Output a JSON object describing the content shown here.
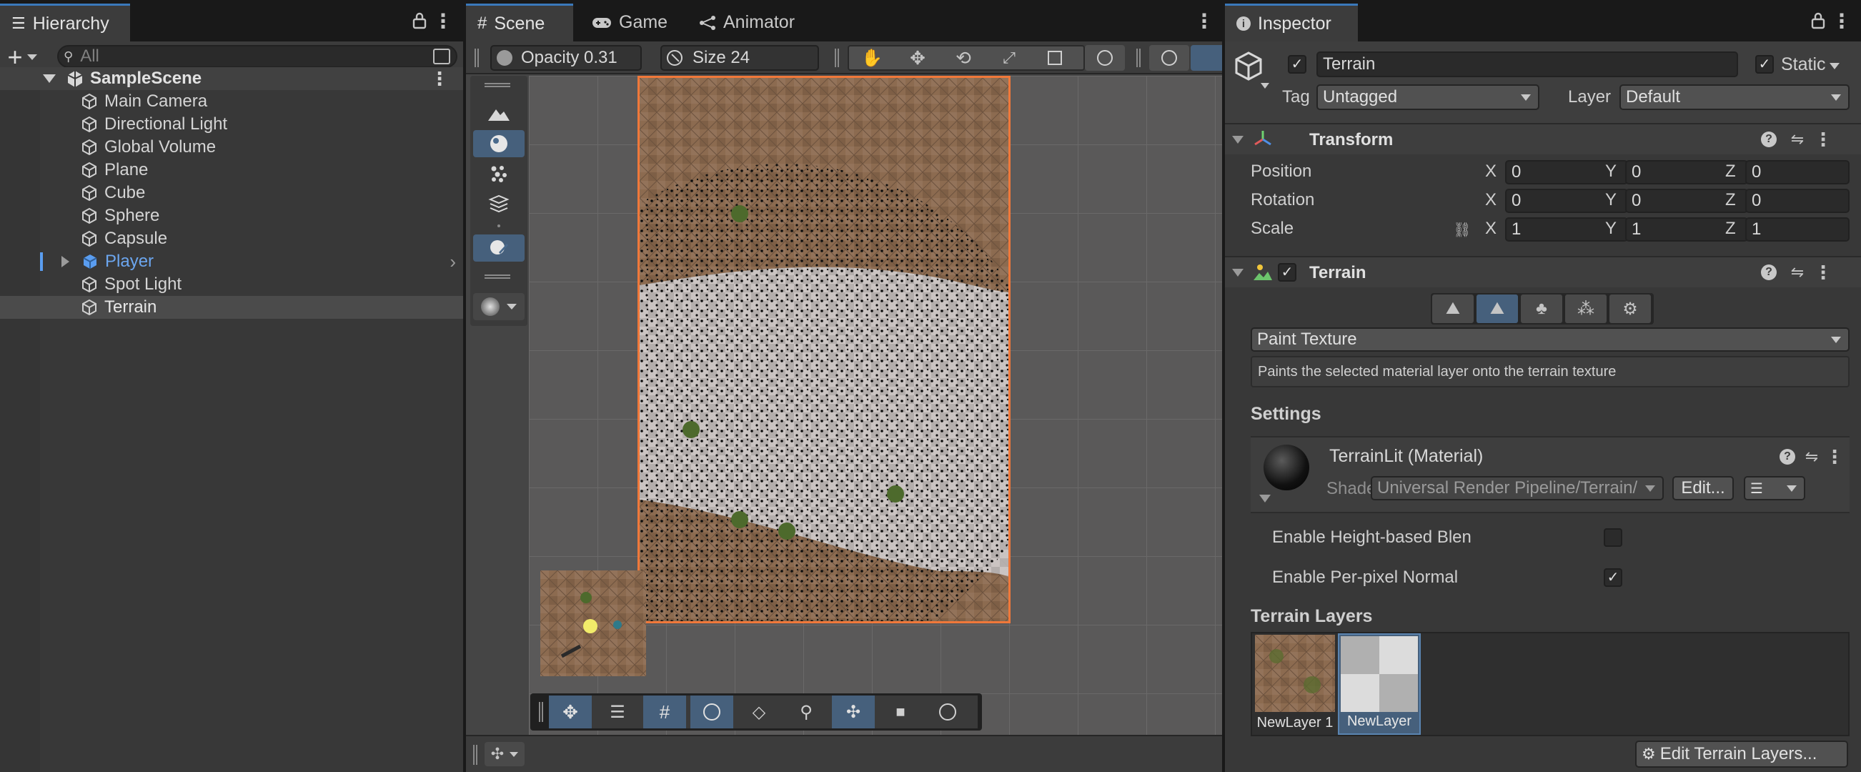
{
  "hierarchy": {
    "tab_label": "Hierarchy",
    "search_placeholder": "All",
    "scene_name": "SampleScene",
    "items": [
      {
        "label": "Main Camera"
      },
      {
        "label": "Directional Light"
      },
      {
        "label": "Global Volume"
      },
      {
        "label": "Plane"
      },
      {
        "label": "Cube"
      },
      {
        "label": "Sphere"
      },
      {
        "label": "Capsule"
      },
      {
        "label": "Player"
      },
      {
        "label": "Spot Light"
      },
      {
        "label": "Terrain"
      }
    ],
    "selected_item": "Terrain",
    "highlight_color": "#5a9df0"
  },
  "scene": {
    "tabs": [
      {
        "label": "Scene"
      },
      {
        "label": "Game"
      },
      {
        "label": "Animator"
      }
    ],
    "active_tab": "Scene",
    "toolbar": {
      "opacity_label": "Opacity 0.31",
      "size_label": "Size 24"
    },
    "selection_color": "#f0783a"
  },
  "inspector": {
    "tab_label": "Inspector",
    "object_name": "Terrain",
    "static_label": "Static",
    "tag_label": "Tag",
    "tag_value": "Untagged",
    "layer_label": "Layer",
    "layer_value": "Default",
    "transform": {
      "title": "Transform",
      "rows": [
        {
          "label": "Position",
          "x": "0",
          "y": "0",
          "z": "0"
        },
        {
          "label": "Rotation",
          "x": "0",
          "y": "0",
          "z": "0"
        },
        {
          "label": "Scale",
          "x": "1",
          "y": "1",
          "z": "1"
        }
      ],
      "axis_x": "X",
      "axis_y": "Y",
      "axis_z": "Z"
    },
    "terrain": {
      "title": "Terrain",
      "tool_dropdown": "Paint Texture",
      "tool_description": "Paints the selected material layer onto the terrain texture",
      "settings_label": "Settings",
      "material_name": "TerrainLit (Material)",
      "shader_label": "Shader",
      "shader_value": "Universal Render Pipeline/Terrain/",
      "edit_label": "Edit...",
      "height_blend_label": "Enable Height-based Blen",
      "per_pixel_normal_label": "Enable Per-pixel Normal",
      "height_blend_checked": false,
      "per_pixel_normal_checked": true,
      "layers_label": "Terrain Layers",
      "layers": [
        {
          "name": "NewLayer 1"
        },
        {
          "name": "NewLayer"
        }
      ],
      "edit_layers_label": "Edit Terrain Layers..."
    }
  },
  "colors": {
    "accent_blue": "#46607c",
    "tab_underline": "#3a79bb",
    "panel_bg": "#383838"
  }
}
